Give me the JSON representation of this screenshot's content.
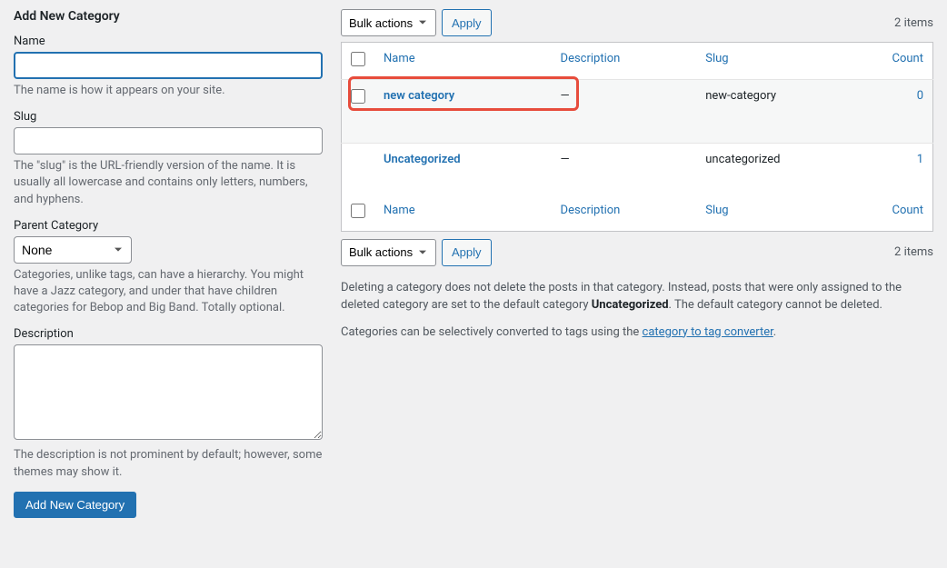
{
  "form": {
    "heading": "Add New Category",
    "name": {
      "label": "Name",
      "help": "The name is how it appears on your site."
    },
    "slug": {
      "label": "Slug",
      "help": "The \"slug\" is the URL-friendly version of the name. It is usually all lowercase and contains only letters, numbers, and hyphens."
    },
    "parent": {
      "label": "Parent Category",
      "selected": "None",
      "help": "Categories, unlike tags, can have a hierarchy. You might have a Jazz category, and under that have children categories for Bebop and Big Band. Totally optional."
    },
    "description": {
      "label": "Description",
      "help": "The description is not prominent by default; however, some themes may show it."
    },
    "submit": "Add New Category"
  },
  "bulk": {
    "label": "Bulk actions",
    "apply": "Apply"
  },
  "items_count": "2 items",
  "columns": {
    "name": "Name",
    "description": "Description",
    "slug": "Slug",
    "count": "Count"
  },
  "rows": [
    {
      "name": "new category",
      "description": "—",
      "slug": "new-category",
      "count": "0"
    },
    {
      "name": "Uncategorized",
      "description": "—",
      "slug": "uncategorized",
      "count": "1"
    }
  ],
  "notes": {
    "line1a": "Deleting a category does not delete the posts in that category. Instead, posts that were only assigned to the deleted category are set to the default category ",
    "line1b": "Uncategorized",
    "line1c": ". The default category cannot be deleted.",
    "line2a": "Categories can be selectively converted to tags using the ",
    "line2link": "category to tag converter",
    "line2b": "."
  }
}
